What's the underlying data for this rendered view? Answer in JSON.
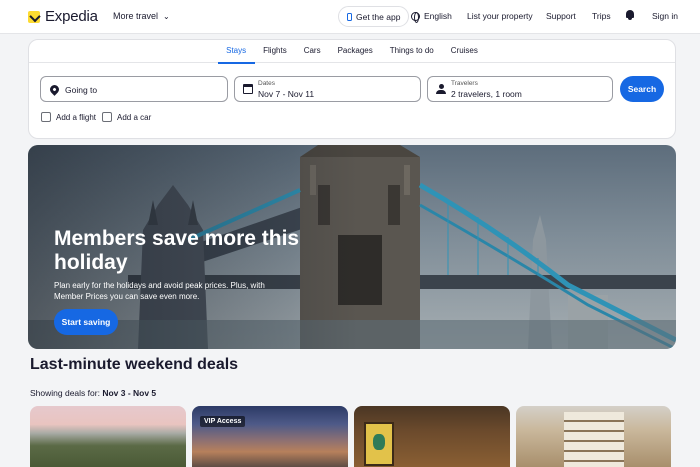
{
  "header": {
    "brand": "Expedia",
    "more_travel": "More travel",
    "get_app": "Get the app",
    "language": "English",
    "list_property": "List your property",
    "support": "Support",
    "trips": "Trips",
    "sign_in": "Sign in"
  },
  "tabs": [
    "Stays",
    "Flights",
    "Cars",
    "Packages",
    "Things to do",
    "Cruises"
  ],
  "active_tab": "Stays",
  "search": {
    "going_to": "Going to",
    "dates_label": "Dates",
    "dates_value": "Nov 7 - Nov 11",
    "travelers_label": "Travelers",
    "travelers_value": "2 travelers, 1 room",
    "button": "Search",
    "add_flight": "Add a flight",
    "add_car": "Add a car"
  },
  "hero": {
    "title": "Members save more this holiday",
    "subtitle": "Plan early for the holidays and avoid peak prices. Plus, with Member Prices you can save even more.",
    "cta": "Start saving"
  },
  "deals": {
    "title": "Last-minute weekend deals",
    "showing_prefix": "Showing deals for:",
    "date_range": "Nov 3 - Nov 5",
    "cards": [
      {
        "badge": ""
      },
      {
        "badge": "VIP Access"
      },
      {
        "badge": ""
      },
      {
        "badge": ""
      }
    ]
  },
  "colors": {
    "brand_blue": "#1668e3",
    "logo_yellow": "#fddb32",
    "text_dark": "#1a1a2e"
  },
  "icons": [
    "expedia-logo-icon",
    "chevron-down-icon",
    "phone-icon",
    "globe-icon",
    "bell-icon",
    "map-pin-icon",
    "calendar-icon",
    "person-icon",
    "checkbox-icon"
  ]
}
